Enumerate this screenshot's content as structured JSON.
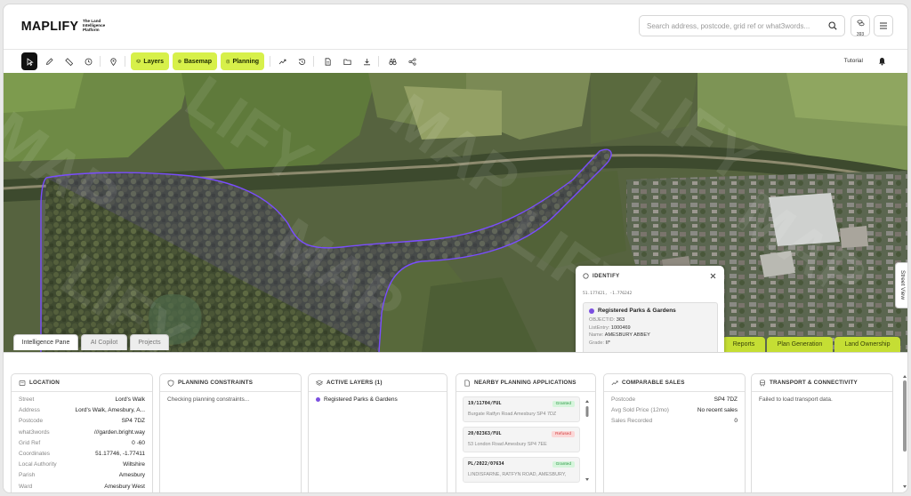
{
  "header": {
    "logo_text": "MAPLIFY",
    "logo_tagline": "The Land Intelligence Platform",
    "search_placeholder": "Search address, postcode, grid ref or what3words...",
    "credits_count": "393"
  },
  "toolbar": {
    "layers_label": "Layers",
    "basemap_label": "Basemap",
    "planning_label": "Planning",
    "tutorial_label": "Tutorial"
  },
  "map": {
    "tabs": [
      "Intelligence Pane",
      "AI Copilot",
      "Projects"
    ],
    "actions": [
      "Reports",
      "Plan Generation",
      "Land Ownership"
    ],
    "street_view_label": "Street View",
    "watermark": "MAPLIFY",
    "boundary_color": "#7a4dff"
  },
  "identify": {
    "title": "IDENTIFY",
    "coords": "51.177421, -1.776242",
    "feature_title": "Registered Parks & Gardens",
    "attributes": [
      {
        "key": "OBJECTID:",
        "value": "363"
      },
      {
        "key": "ListEntry:",
        "value": "1000469"
      },
      {
        "key": "Name:",
        "value": "AMESBURY ABBEY"
      },
      {
        "key": "Grade:",
        "value": "II*"
      }
    ]
  },
  "panel": {
    "location": {
      "title": "LOCATION",
      "rows": [
        {
          "k": "Street",
          "v": "Lord's Walk"
        },
        {
          "k": "Address",
          "v": "Lord's Walk, Amesbury, A..."
        },
        {
          "k": "Postcode",
          "v": "SP4 7DZ"
        },
        {
          "k": "what3words",
          "v": "///garden.bright.way"
        },
        {
          "k": "Grid Ref",
          "v": "0 -60"
        },
        {
          "k": "Coordinates",
          "v": "51.17746, -1.77411"
        },
        {
          "k": "Local Authority",
          "v": "Wiltshire"
        },
        {
          "k": "Parish",
          "v": "Amesbury"
        },
        {
          "k": "Ward",
          "v": "Amesbury West"
        }
      ]
    },
    "planning_constraints": {
      "title": "PLANNING CONSTRAINTS",
      "status": "Checking planning constraints..."
    },
    "active_layers": {
      "title": "ACTIVE LAYERS (1)",
      "items": [
        "Registered Parks & Gardens"
      ]
    },
    "nearby_planning": {
      "title": "NEARBY PLANNING APPLICATIONS",
      "items": [
        {
          "ref": "19/11704/FUL",
          "status": "Granted",
          "address": "Burgate Ratfyn Road Amesbury SP4 7DZ"
        },
        {
          "ref": "20/02363/FUL",
          "status": "Refused",
          "address": "53 London Road Amesbury SP4 7EE"
        },
        {
          "ref": "PL/2022/07634",
          "status": "Granted",
          "address": "LINDISFARNE, RATFYN ROAD, AMESBURY,"
        }
      ]
    },
    "comparable_sales": {
      "title": "COMPARABLE SALES",
      "rows": [
        {
          "k": "Postcode",
          "v": "SP4 7DZ"
        },
        {
          "k": "Avg Sold Price (12mo)",
          "v": "No recent sales"
        },
        {
          "k": "Sales Recorded",
          "v": "0"
        }
      ]
    },
    "transport": {
      "title": "TRANSPORT & CONNECTIVITY",
      "status": "Failed to load transport data."
    }
  }
}
